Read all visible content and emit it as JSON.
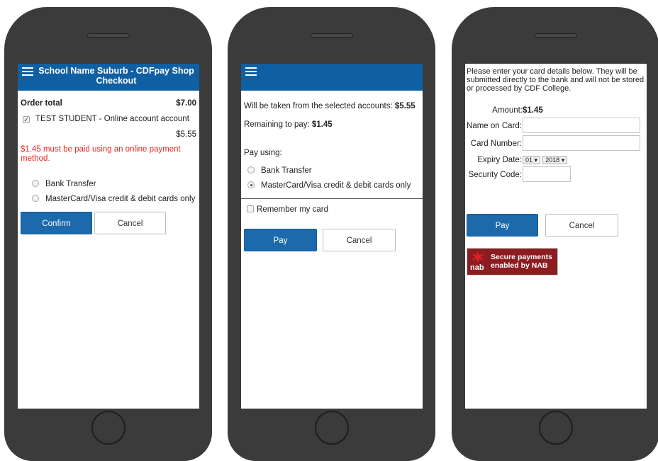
{
  "screen1": {
    "header_title": "School Name Suburb - CDFpay Shop Checkout",
    "order_total_label": "Order total",
    "order_total_value": "$7.00",
    "account_label": "TEST STUDENT - Online account account",
    "account_amount": "$5.55",
    "warning": "$1.45 must be paid using an online payment method.",
    "options": [
      "Bank Transfer",
      "MasterCard/Visa credit & debit cards only"
    ],
    "confirm_label": "Confirm",
    "cancel_label": "Cancel"
  },
  "screen2": {
    "taken_text": "Will be taken from the selected accounts: ",
    "taken_amount": "$5.55",
    "remaining_text": "Remaining to pay: ",
    "remaining_amount": "$1.45",
    "pay_using": "Pay using:",
    "options": [
      "Bank Transfer",
      "MasterCard/Visa credit & debit cards only"
    ],
    "selected_option": "MasterCard/Visa credit & debit cards only",
    "remember_label": "Remember my card",
    "pay_label": "Pay",
    "cancel_label": "Cancel"
  },
  "screen3": {
    "intro": "Please enter your card details below. They will be submitted directly to the bank and will not be stored or processed by CDF College.",
    "amount_label": "Amount: ",
    "amount_value": "$1.45",
    "name_label": "Name on Card:",
    "number_label": "Card Number:",
    "expiry_label": "Expiry Date:",
    "expiry_month": "01 ▾",
    "expiry_year": "2018 ▾",
    "security_label": "Security Code:",
    "pay_label": "Pay",
    "cancel_label": "Cancel",
    "nab_word": "nab",
    "nab_badge_line1": "Secure payments",
    "nab_badge_line2": "enabled by NAB"
  },
  "colors": {
    "header_blue": "#0f5fa3",
    "button_blue": "#1c6aab",
    "warning_red": "#e8271f",
    "nab_red": "#8c1c20",
    "phone_body": "#3b3b3b"
  }
}
